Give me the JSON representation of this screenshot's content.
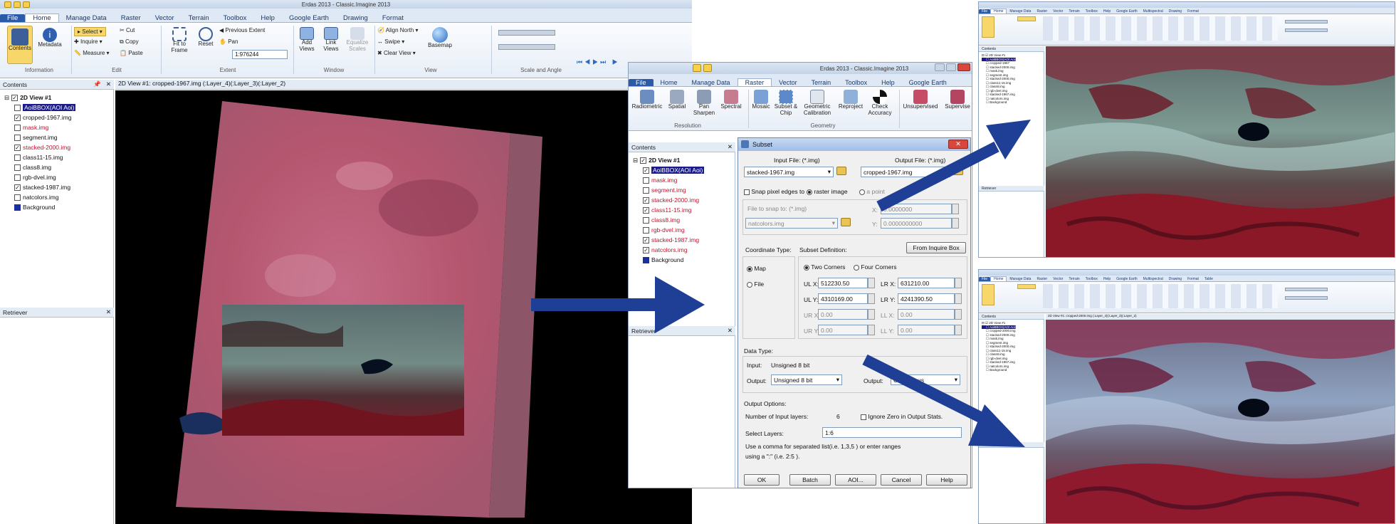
{
  "left_app": {
    "title": "Erdas 2013 - Classic.Imagine 2013",
    "tabs": [
      "File",
      "Home",
      "Manage Data",
      "Raster",
      "Vector",
      "Terrain",
      "Toolbox",
      "Help",
      "Google Earth",
      "Drawing",
      "Format"
    ],
    "ribbon": {
      "contents": "Contents",
      "metadata": "Metadata",
      "information": "Information",
      "select": "Select",
      "cut": "Cut",
      "copy": "Copy",
      "paste": "Paste",
      "inquire": "Inquire",
      "measure": "Measure",
      "edit": "Edit",
      "fit_to_frame": "Fit to Frame",
      "reset": "Reset",
      "previous_extent": "Previous Extent",
      "pan": "Pan",
      "scale_value": "1:976244",
      "extent": "Extent",
      "add_views": "Add Views",
      "link_views": "Link Views",
      "equalize_scales": "Equalize Scales",
      "window": "Window",
      "align_north": "Align North",
      "swipe": "Swipe",
      "clear_view": "Clear View",
      "basemap": "Basemap",
      "view": "View",
      "scale_and_angle": "Scale and Angle"
    },
    "contents_header": "Contents",
    "view_header": "2D View #1: cropped-1967.img (:Layer_4)(:Layer_3)(:Layer_2)",
    "tree_root": "2D View #1",
    "layers": [
      {
        "name": "AoiBBOX(AOI Aoi)",
        "checked": false,
        "color": "#1a1a8a",
        "highlight": true
      },
      {
        "name": "cropped-1967.img",
        "checked": true,
        "color": "#111111"
      },
      {
        "name": "mask.img",
        "checked": false,
        "color": "#c0142b"
      },
      {
        "name": "segment.img",
        "checked": false,
        "color": "#111111"
      },
      {
        "name": "stacked-2000.img",
        "checked": true,
        "color": "#c0142b"
      },
      {
        "name": "class11-15.img",
        "checked": false,
        "color": "#111111"
      },
      {
        "name": "class8.img",
        "checked": false,
        "color": "#111111"
      },
      {
        "name": "rgb-dvel.img",
        "checked": false,
        "color": "#111111"
      },
      {
        "name": "stacked-1987.img",
        "checked": true,
        "color": "#111111"
      },
      {
        "name": "natcolors.img",
        "checked": false,
        "color": "#111111"
      }
    ],
    "background": "Background",
    "retriever_header": "Retriever"
  },
  "middle_app": {
    "title": "Erdas 2013 - Classic.Imagine 2013",
    "tabs": [
      "File",
      "Home",
      "Manage Data",
      "Raster",
      "Vector",
      "Terrain",
      "Toolbox",
      "Help",
      "Google Earth"
    ],
    "ribbon": {
      "radiometric": "Radiometric",
      "spatial": "Spatial",
      "pan_sharpen": "Pan Sharpen",
      "spectral": "Spectral",
      "resolution": "Resolution",
      "mosaic": "Mosaic",
      "subset_chip": "Subset & Chip",
      "geometric_calibration": "Geometric Calibration",
      "reproject": "Reproject",
      "check_accuracy": "Check Accuracy",
      "geometry": "Geometry",
      "unsupervised": "Unsupervised",
      "supervised": "Supervise"
    },
    "contents_header": "Contents",
    "tree_root": "2D View #1",
    "layers": [
      {
        "name": "AoiBBOX(AOI Aoi)",
        "checked": true,
        "color": "#1a1a8a",
        "highlight": true
      },
      {
        "name": "mask.img",
        "checked": false,
        "color": "#c0142b"
      },
      {
        "name": "segment.img",
        "checked": false,
        "color": "#c0142b"
      },
      {
        "name": "stacked-2000.img",
        "checked": true,
        "color": "#c0142b"
      },
      {
        "name": "class11-15.img",
        "checked": true,
        "color": "#c0142b"
      },
      {
        "name": "class8.img",
        "checked": false,
        "color": "#c0142b"
      },
      {
        "name": "rgb-dvel.img",
        "checked": false,
        "color": "#c0142b"
      },
      {
        "name": "stacked-1987.img",
        "checked": true,
        "color": "#c0142b"
      },
      {
        "name": "natcolors.img",
        "checked": true,
        "color": "#c0142b"
      }
    ],
    "background": "Background",
    "retriever_header": "Retriever"
  },
  "subset_dialog": {
    "title": "Subset",
    "input_file_label": "Input File: (*.img)",
    "input_file_value": "stacked-1967.img",
    "output_file_label": "Output File: (*.img)",
    "output_file_value": "cropped-1967.img",
    "snap_label": "Snap pixel edges to",
    "raster_image": "raster image",
    "a_point": "a point",
    "file_to_snap": "File to snap to: (*.img)",
    "snap_file_value": "natcolors.img",
    "snap_x_label": "X:",
    "snap_y_label": "Y:",
    "snap_x_value": "0.0000000",
    "snap_y_value": "0.0000000000",
    "coordinate_type": "Coordinate Type:",
    "subset_definition": "Subset Definition:",
    "from_inquire_box": "From Inquire Box",
    "map": "Map",
    "file": "File",
    "two_corners": "Two Corners",
    "four_corners": "Four Corners",
    "ulx_label": "UL X:",
    "ulx_value": "512230.50",
    "lrx_label": "LR X:",
    "lrx_value": "631210.00",
    "uly_label": "UL Y:",
    "uly_value": "4310169.00",
    "lry_label": "LR Y:",
    "lry_value": "4241390.50",
    "urx_label": "UR X:",
    "urx_value": "0.00",
    "llx_label": "LL X:",
    "llx_value": "0.00",
    "ury_label": "UR Y:",
    "ury_value": "0.00",
    "lly_label": "LL Y:",
    "lly_value": "0.00",
    "data_type": "Data Type:",
    "input_label": "Input:",
    "input_type": "Unsigned 8 bit",
    "output_label": "Output:",
    "output_type": "Unsigned 8 bit",
    "output2_label": "Output:",
    "output2_type": "Continuous",
    "output_options": "Output Options:",
    "num_layers_label": "Number of Input layers:",
    "num_layers_value": "6",
    "ignore_zero": "Ignore Zero in Output Stats.",
    "select_layers_label": "Select Layers:",
    "select_layers_value": "1:6",
    "help_text_1": "Use a comma for separated list(i.e. 1,3,5 ) or enter ranges",
    "help_text_2": "using a \":\" (i.e. 2:5 ).",
    "buttons": [
      "OK",
      "Batch",
      "AOI...",
      "Cancel",
      "Help"
    ]
  },
  "top_right_app": {
    "tabs": [
      "File",
      "Home",
      "Manage Data",
      "Raster",
      "Vector",
      "Terrain",
      "Toolbox",
      "Help",
      "Google Earth",
      "Multispectral",
      "Drawing",
      "Format"
    ],
    "contents_header": "Contents",
    "tree_root": "2D View #1",
    "layers": [
      "AoiBBOX(AOI Aoi)",
      "cropped-1967",
      "stacked-2000.img",
      "mask.img",
      "segment.img",
      "stacked-2000.img",
      "class11-15.img",
      "class8.img",
      "rgb-dvel.img",
      "stacked-1967.img",
      "natcolors.img",
      "Background"
    ],
    "retriever_header": "Retriever"
  },
  "bottom_right_app": {
    "tabs": [
      "File",
      "Home",
      "Manage Data",
      "Raster",
      "Vector",
      "Terrain",
      "Toolbox",
      "Help",
      "Google Earth",
      "Multispectral",
      "Drawing",
      "Format",
      "Table"
    ],
    "contents_header": "Contents",
    "tree_root": "2D View #1",
    "layers": [
      "AoiBBOX(AOI Aoi)",
      "cropped-2000.img",
      "stacked-2000.img",
      "mask.img",
      "segment.img",
      "stacked-2000.img",
      "class11-15.img",
      "class8.img",
      "rgb-dvel.img",
      "stacked-1967.img",
      "natcolors.img",
      "Background"
    ],
    "view_header": "2D View #1: cropped-2000.img (:Layer_4)(:Layer_3)(:Layer_2)",
    "retriever_header": "Retriever"
  },
  "colors": {
    "arrow": "#1f3f96",
    "ribbon_accent": "#f5d24a",
    "file_tab": "#2b5aa8",
    "false_color_pink": "#b5566f"
  }
}
